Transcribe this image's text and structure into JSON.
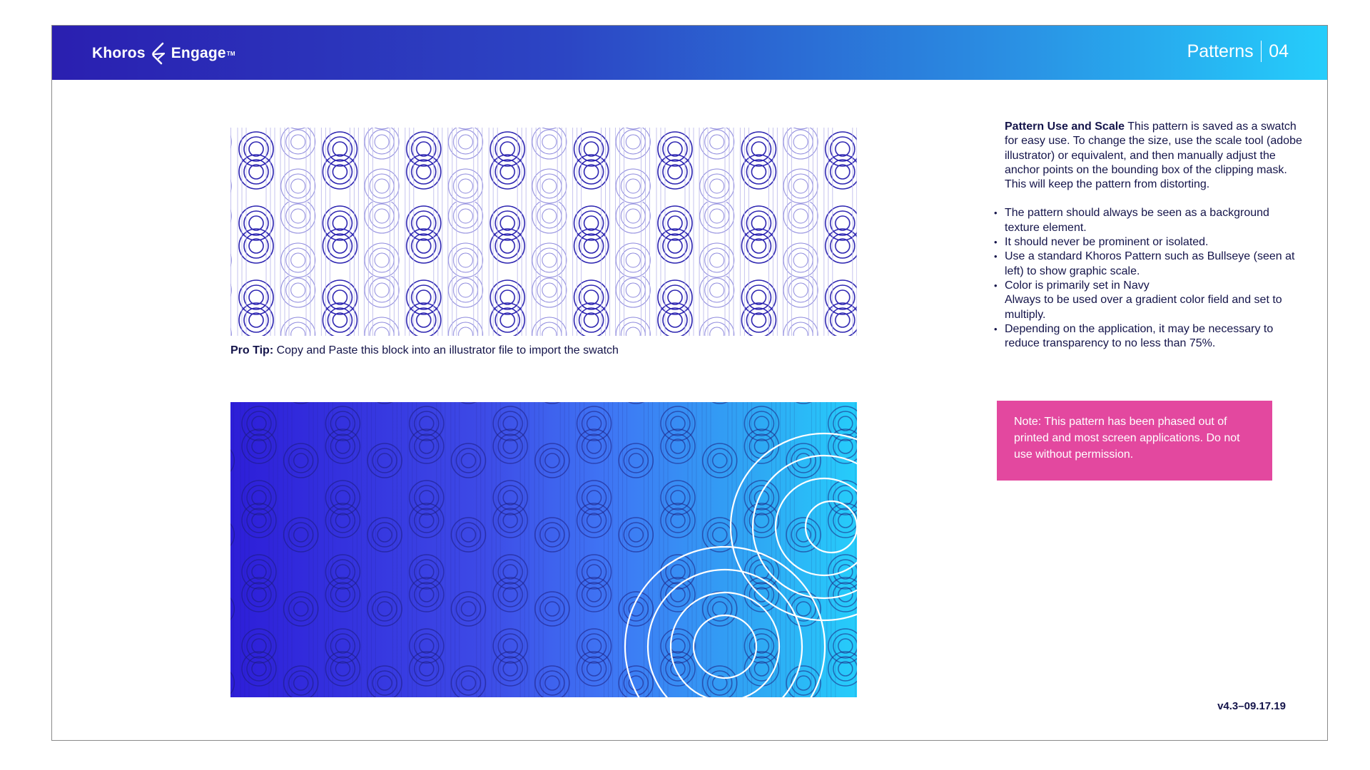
{
  "header": {
    "brand_left": "Khoros",
    "brand_right": "Engage",
    "trademark": "TM",
    "section_title": "Patterns",
    "page_number": "04",
    "gradient_colors": [
      "#2a1fb0",
      "#2c45c4",
      "#2a8fe3",
      "#25cdfb"
    ]
  },
  "pro_tip": {
    "label": "Pro Tip:",
    "text": " Copy and Paste this block into an illustrator file to import the swatch"
  },
  "description": {
    "heading": "Pattern Use and Scale",
    "body": " This pattern is saved as a swatch for easy use. To change the size, use the scale tool (adobe illustrator) or equivalent, and then manually adjust the anchor points on the bounding box of the clipping mask. This will keep the pattern from distorting.",
    "bullets": [
      "The pattern should always be seen as a background texture element.",
      "It should never be prominent or isolated.",
      "Use a standard Khoros Pattern such as Bullseye (seen at left) to show graphic scale.",
      "Color is primarily set in Navy\nAlways to be used over a gradient color field and set to multiply.",
      "Depending on the application, it may be necessary to reduce transparency to no less than 75%."
    ]
  },
  "note": {
    "text": "Note: This pattern has been phased out of printed and most screen applications. Do not use without permission.",
    "color": "#e3489f"
  },
  "version": "v4.3–09.17.19",
  "colors": {
    "navy": "#14144a",
    "pattern_navy": "#2a22b0",
    "gradient_start": "#2d1ed8",
    "gradient_end": "#26cdfb"
  }
}
